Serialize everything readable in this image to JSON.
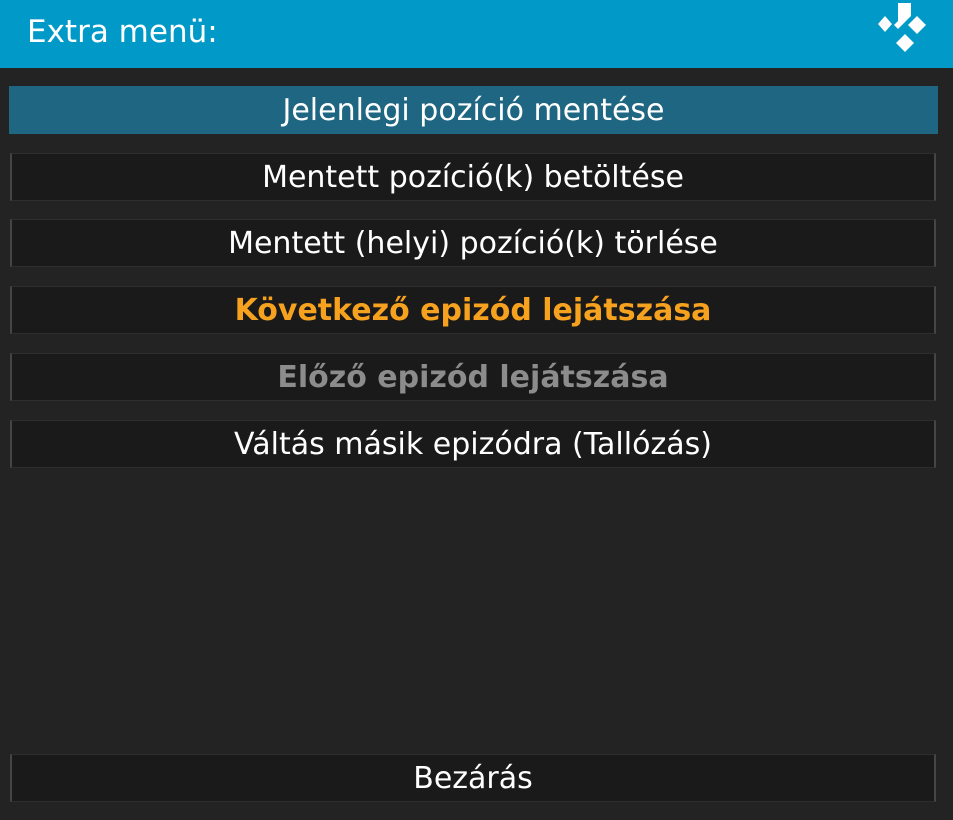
{
  "dialog": {
    "title": "Extra menü:",
    "logo_icon": "kodi-logo-icon",
    "accent_color": "#0199c8",
    "focus_color": "#1e6682",
    "highlight_color": "#f6a21f"
  },
  "menu": {
    "items": [
      {
        "label": "Jelenlegi pozíció mentése",
        "state": "focused"
      },
      {
        "label": "Mentett pozíció(k) betöltése",
        "state": "normal"
      },
      {
        "label": "Mentett (helyi) pozíció(k) törlése",
        "state": "normal"
      },
      {
        "label": "Következő epizód lejátszása",
        "state": "highlighted"
      },
      {
        "label": "Előző epizód lejátszása",
        "state": "dimmed"
      },
      {
        "label": "Váltás másik epizódra (Tallózás)",
        "state": "normal"
      }
    ]
  },
  "footer": {
    "close_label": "Bezárás"
  }
}
